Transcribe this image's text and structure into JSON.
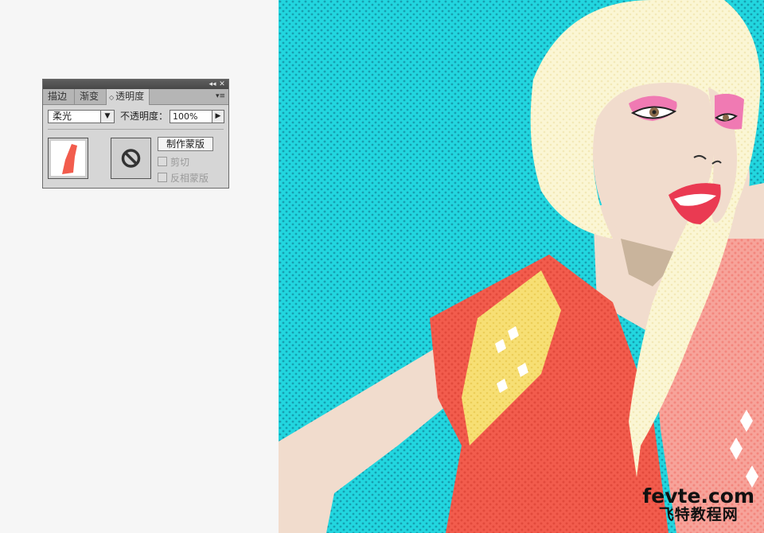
{
  "panel": {
    "tabs": [
      {
        "label": "描边"
      },
      {
        "label": "渐变"
      },
      {
        "label": "透明度"
      }
    ],
    "blend_mode": "柔光",
    "opacity_label": "不透明度：",
    "opacity_value": "100%",
    "make_mask_label": "制作蒙版",
    "clip_label": "剪切",
    "invert_mask_label": "反相蒙版",
    "icons": {
      "collapse": "collapse-double-arrow-icon",
      "close": "close-icon",
      "menu": "panel-menu-icon",
      "no_mask": "no-symbol-icon"
    }
  },
  "watermark": {
    "main": "fevte.com",
    "sub": "飞特教程网"
  },
  "colors": {
    "background_cyan": "#22d6df",
    "hair": "#fbf6d4",
    "skin": "#f1dccd",
    "vest_red": "#f25c4d",
    "patch_yellow": "#f7df74",
    "lips": "#ea3a52",
    "eyeshadow": "#f07ab3"
  }
}
